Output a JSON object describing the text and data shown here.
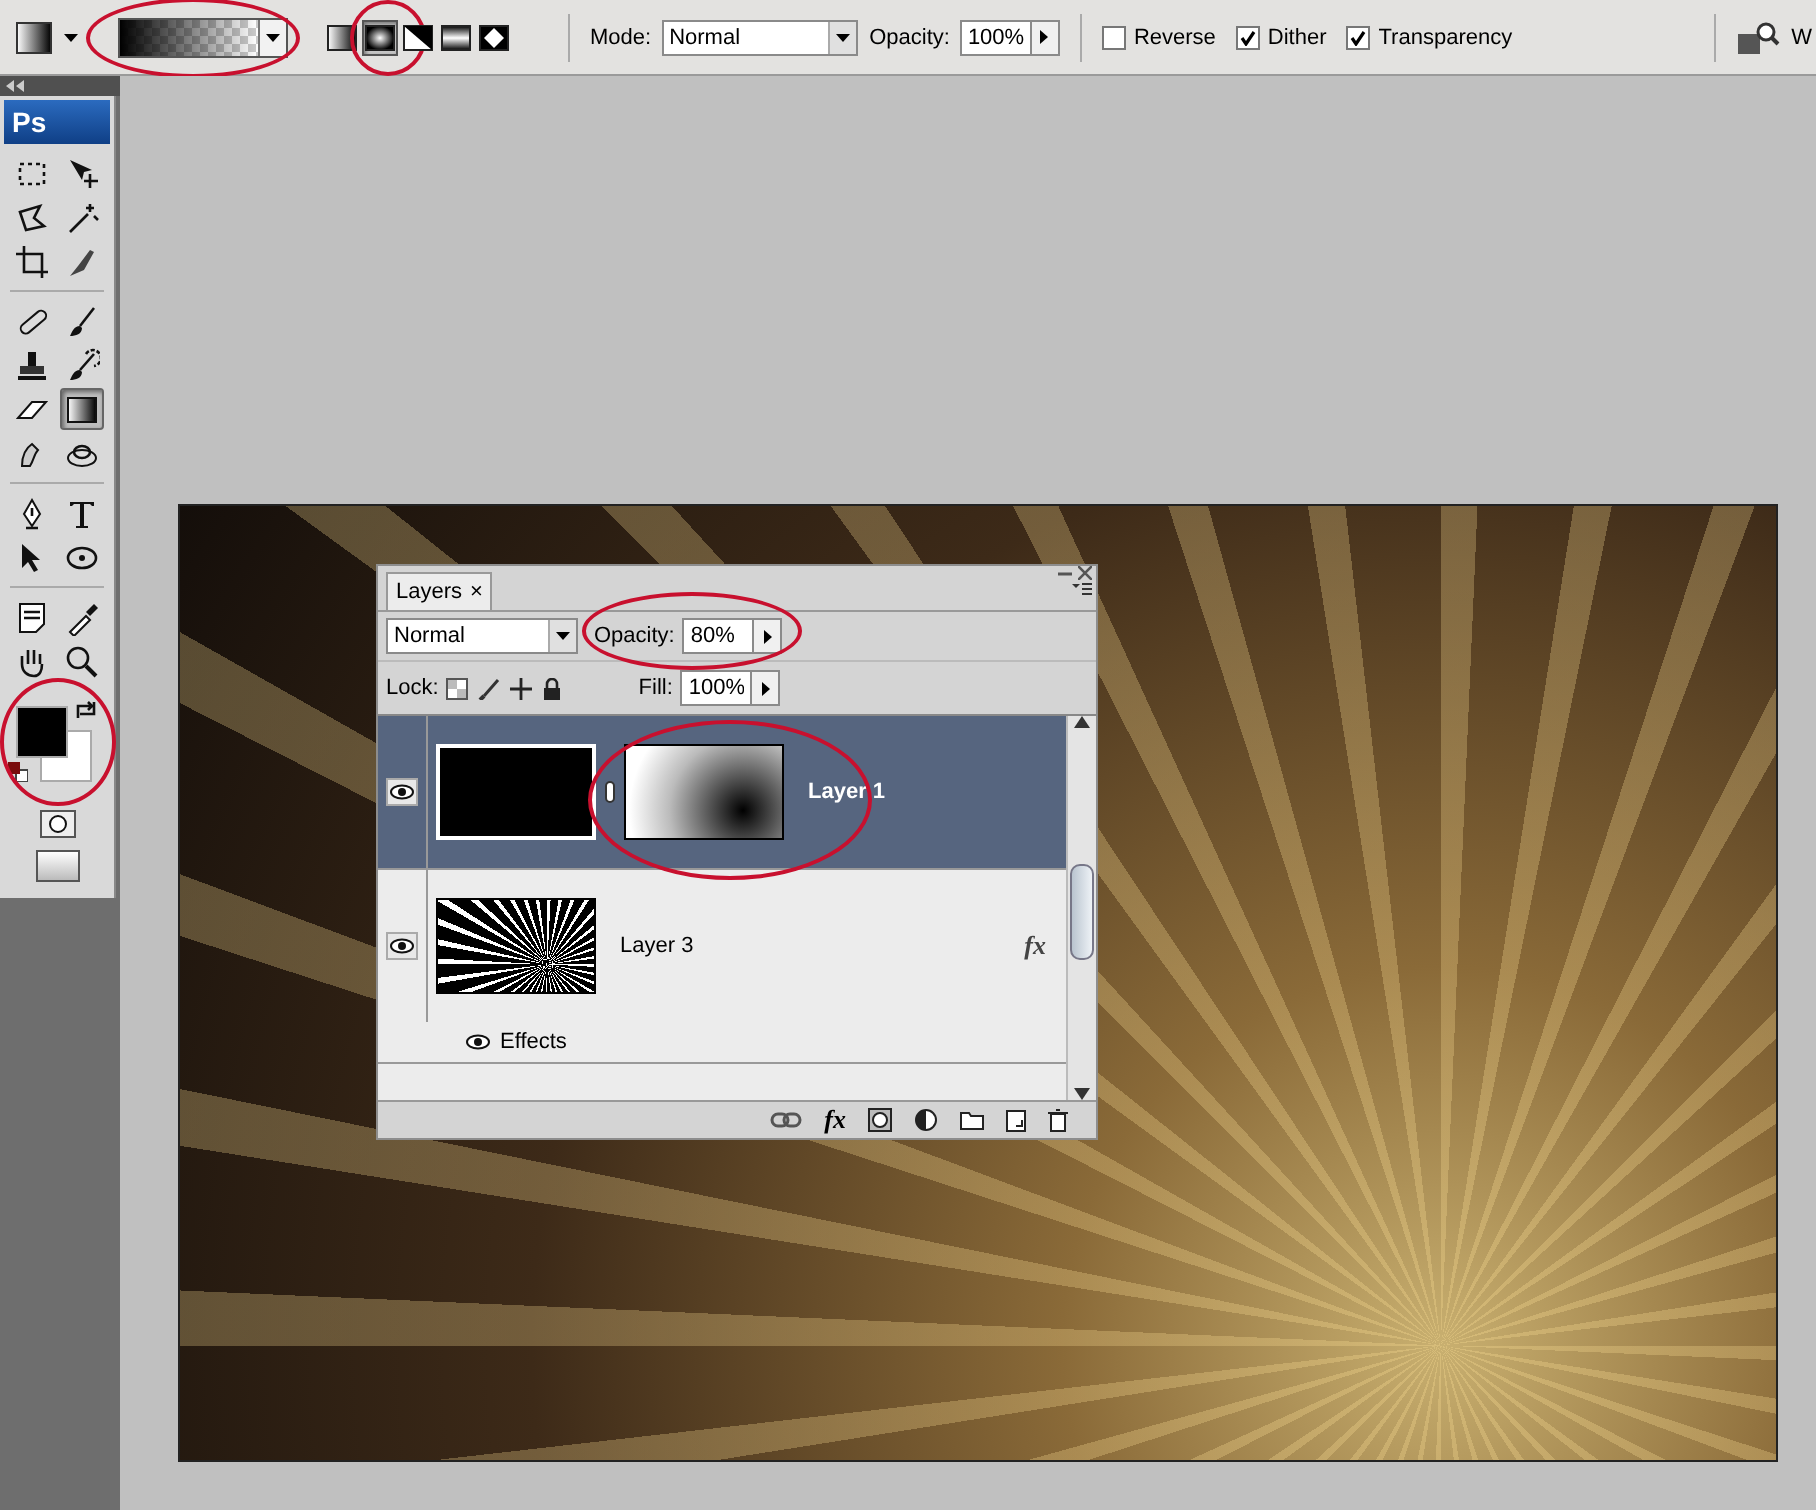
{
  "toolbar": {
    "gradient_picker": {
      "circled": true
    },
    "gradient_types": [
      {
        "selected": false,
        "circled": false
      },
      {
        "selected": true,
        "circled": true
      },
      {
        "selected": false,
        "circled": false
      },
      {
        "selected": false,
        "circled": false
      },
      {
        "selected": false,
        "circled": false
      }
    ],
    "mode": {
      "label": "Mode:",
      "value": "Normal"
    },
    "opacity": {
      "label": "Opacity:",
      "value": "100%"
    },
    "options": [
      {
        "label": "Reverse",
        "checked": false
      },
      {
        "label": "Dither",
        "checked": true
      },
      {
        "label": "Transparency",
        "checked": true
      }
    ],
    "cut_off_text": "W"
  },
  "toolbox": {
    "logo": "Ps",
    "tools": [
      {
        "selected": false
      },
      {
        "selected": false
      },
      {
        "selected": false
      },
      {
        "selected": false
      },
      {
        "selected": false
      },
      {
        "selected": false
      },
      {
        "selected": false
      },
      {
        "selected": false
      },
      {
        "selected": false
      },
      {
        "selected": false
      },
      {
        "selected": false
      },
      {
        "selected": true
      },
      {
        "selected": false
      },
      {
        "selected": false
      },
      {
        "selected": false
      },
      {
        "selected": false
      },
      {
        "selected": false
      },
      {
        "selected": false
      },
      {
        "selected": false
      },
      {
        "selected": false
      },
      {
        "selected": false
      },
      {
        "selected": false
      }
    ],
    "colors": {
      "circled": true
    }
  },
  "layers_panel": {
    "tab": "Layers",
    "tab_close": "×",
    "blend_mode": "Normal",
    "opacity": {
      "label": "Opacity:",
      "value": "80%",
      "circled": true
    },
    "lock_label": "Lock:",
    "fill": {
      "label": "Fill:",
      "value": "100%"
    },
    "layers": [
      {
        "kind": "masked",
        "name": "Layer 1",
        "selected": true,
        "visible": true,
        "mask_circled": true
      },
      {
        "kind": "effects",
        "name": "Layer 3",
        "selected": false,
        "visible": true,
        "effects_badge": "fx",
        "effects": [
          {
            "name": "Effects",
            "visible": true
          }
        ]
      }
    ],
    "footer_fx": "fx"
  }
}
